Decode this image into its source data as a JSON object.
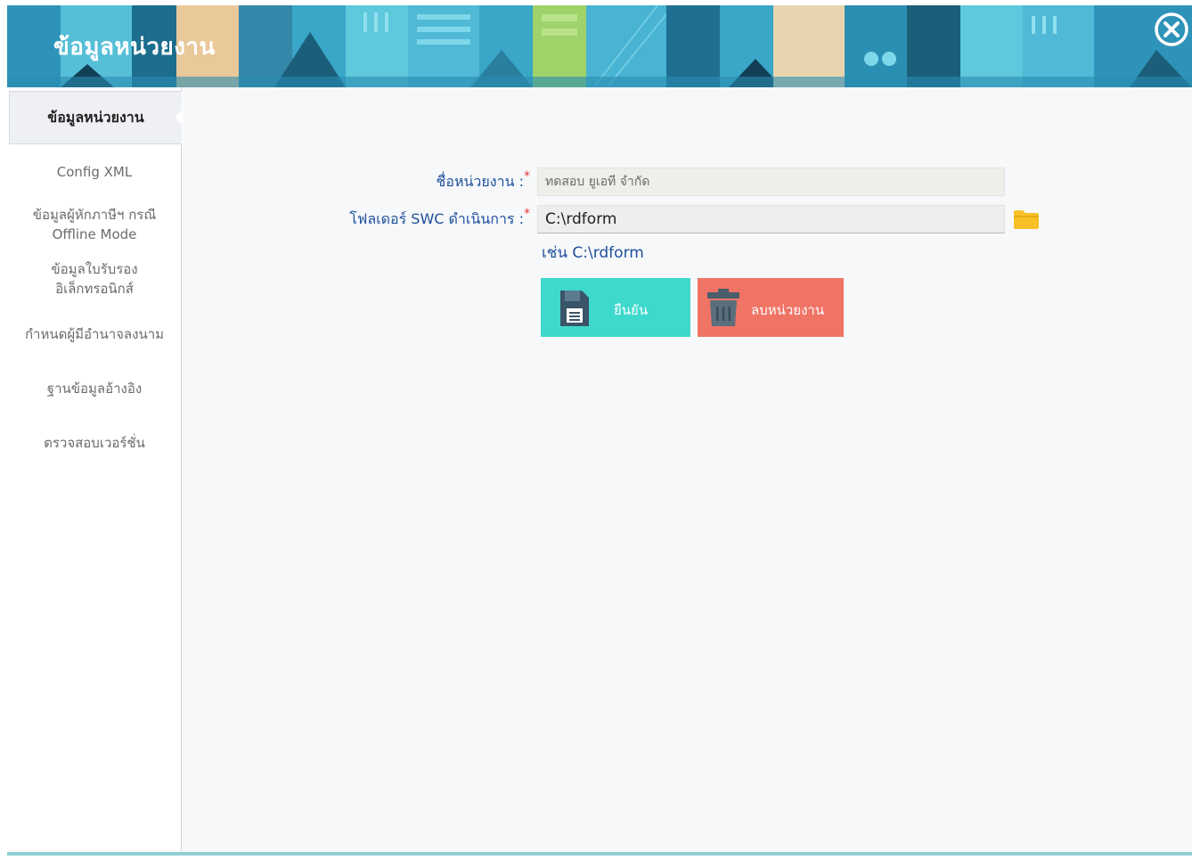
{
  "window": {
    "title": "ข้อมูลหน่วยงาน",
    "close_icon": "close-circle-icon"
  },
  "colors": {
    "banner_base": "#3aa6c8",
    "confirm_button": "#3ed8cc",
    "delete_button": "#f07466",
    "label_text": "#1f4f9c",
    "required_star": "#e53935",
    "folder_icon": "#f6c026"
  },
  "sidebar": {
    "items": [
      {
        "label": "ข้อมูลหน่วยงาน",
        "active": true
      },
      {
        "label": "Config XML"
      },
      {
        "line1": "ข้อมูลผู้หักภาษีฯ กรณี",
        "line2": "Offline Mode"
      },
      {
        "line1": "ข้อมูลใบรับรอง",
        "line2": "อิเล็กทรอนิกส์"
      },
      {
        "label": "กำหนดผู้มีอำนาจลงนาม"
      },
      {
        "label": "ฐานข้อมูลอ้างอิง"
      },
      {
        "label": "ตรวจสอบเวอร์ชั่น"
      }
    ]
  },
  "form": {
    "org_name": {
      "label": "ชื่อหน่วยงาน :",
      "required_mark": "*",
      "value": "ทดสอบ ยูเอที จำกัด"
    },
    "swc_folder": {
      "label": "โฟลเดอร์ SWC ดำเนินการ :",
      "required_mark": "*",
      "value": "C:\\rdform",
      "hint": "เช่น C:\\rdform",
      "browse_icon": "folder-icon"
    }
  },
  "actions": {
    "confirm": {
      "label": "ยืนยัน",
      "icon": "save-document-icon"
    },
    "delete": {
      "label": "ลบหน่วยงาน",
      "icon": "trash-icon"
    }
  }
}
